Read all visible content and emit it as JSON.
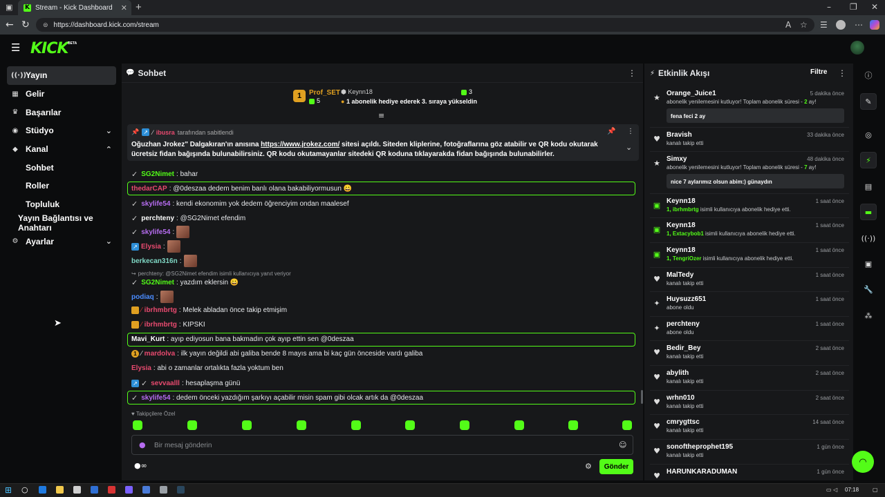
{
  "browser": {
    "tab_title": "Stream - Kick Dashboard",
    "url": "https://dashboard.kick.com/stream"
  },
  "header": {
    "logo": "KICK",
    "beta": "BETA"
  },
  "sidebar": {
    "items": [
      {
        "label": "Yayın",
        "icon": "broadcast-icon"
      },
      {
        "label": "Gelir",
        "icon": "revenue-icon"
      },
      {
        "label": "Başarılar",
        "icon": "trophy-icon"
      },
      {
        "label": "Stüdyo",
        "icon": "studio-icon"
      },
      {
        "label": "Kanal",
        "icon": "channel-icon"
      },
      {
        "label": "Sohbet"
      },
      {
        "label": "Roller"
      },
      {
        "label": "Topluluk"
      },
      {
        "label": "Yayın Bağlantısı ve Anahtarı"
      },
      {
        "label": "Ayarlar",
        "icon": "gear-icon"
      }
    ]
  },
  "chat": {
    "title": "Sohbet",
    "leaderboard": {
      "rank": "1",
      "user": "Prof_SET",
      "gifts": "5",
      "second_user": "Keynn18",
      "second_count": "3",
      "notice": "1 abonelik hediye ederek 3. sıraya yükseldin"
    },
    "pinned": {
      "pinned_by_user": "ibusra",
      "pinned_by_suffix": "tarafından sabitlendi",
      "text_before": "Oğuzhan Jrokez\" Dalgakıran'ın anısına",
      "link": "https://www.jrokez.com/",
      "text_after": "sitesi açıldı. Siteden kliplerine, fotoğraflarına göz atabilir ve QR kodu okutarak ücretsiz fidan",
      "text_line2": "bağışında bulunabilirsiniz. QR kodu okutamayanlar sitedeki QR koduna tıklayarakda fidan bağışında bulunabilirler."
    },
    "messages": [
      {
        "user": "SG2Nimet",
        "text": ": bahar"
      },
      {
        "user": "thedarCAP",
        "text": ": @0deszaa dedem benim banlı olana bakabiliyormusun 😀"
      },
      {
        "user": "skylife54",
        "text": ": kendi ekonomim yok dedem öğrenciyim ondan maalesef"
      },
      {
        "user": "perchteny",
        "text": ": @SG2Nimet efendim"
      },
      {
        "user": "skylife54",
        "text": ":"
      },
      {
        "user": "Elysia",
        "text": ":"
      },
      {
        "user": "berkecan316n",
        "text": ":"
      },
      {
        "reply": "perchteny: @SG2Nimet efendim isimli kullanıcıya yanıt veriyor"
      },
      {
        "user": "SG2Nimet",
        "text": ": yazdım eklersin 😀"
      },
      {
        "user": "podiaq",
        "text": ":"
      },
      {
        "user": "ibrhmbrtg",
        "text": ": Melek abladan önce takip etmişim"
      },
      {
        "user": "ibrhmbrtg",
        "text": ": KIPSKI"
      },
      {
        "user": "Mavi_Kurt",
        "text": ": ayıp ediyosun bana bakmadın çok ayıp ettin sen @0deszaa"
      },
      {
        "user": "mardolva",
        "text": ": ilk yayın değildi abi galiba bende 8 mayıs ama bi kaç gün önceside vardı galiba"
      },
      {
        "user": "Elysia",
        "text": ": abi o zamanlar ortalıkta fazla yoktum ben"
      },
      {
        "user": "sevvaalll",
        "text": ": hesaplaşma günü"
      },
      {
        "user": "skylife54",
        "text": ": dedem önceki yazdığım şarkıyı açabilir misin spam gibi olcak artık da @0deszaa"
      }
    ],
    "emote_section": "Takipçilere Özel",
    "input_placeholder": "Bir mesaj gönderin",
    "send_label": "Gönder"
  },
  "activity": {
    "title": "Etkinlik Akışı",
    "filter_label": "Filtre",
    "events": [
      {
        "name": "Orange_Juice1",
        "time": "5 dakika önce",
        "desc": "abonelik yenilemesini kutluyor! Toplam abonelik süresi -",
        "count": "2",
        "suffix": "ay!",
        "note": "fena feci 2 ay"
      },
      {
        "name": "Bravish",
        "time": "33 dakika önce",
        "desc": "kanalı takip etti"
      },
      {
        "name": "Simxy",
        "time": "48 dakika önce",
        "desc": "abonelik yenilemesini kutluyor! Toplam abonelik süresi -",
        "count": "7",
        "suffix": "ay!",
        "note": "nice 7 aylarımız olsun abim:) günaydın"
      },
      {
        "name": "Keynn18",
        "time": "1 saat önce",
        "gift": "1, ibrhmbrtg",
        "desc": "isimli kullanıcıya abonelik hediye etti."
      },
      {
        "name": "Keynn18",
        "time": "1 saat önce",
        "gift": "1, Extacybob1",
        "desc": "isimli kullanıcıya abonelik hediye etti."
      },
      {
        "name": "Keynn18",
        "time": "1 saat önce",
        "gift": "1, TengriOzer",
        "desc": "isimli kullanıcıya abonelik hediye etti."
      },
      {
        "name": "MalTedy",
        "time": "1 saat önce",
        "desc": "kanalı takip etti"
      },
      {
        "name": "Huysuzz651",
        "time": "1 saat önce",
        "desc": "abone oldu"
      },
      {
        "name": "perchteny",
        "time": "1 saat önce",
        "desc": "abone oldu"
      },
      {
        "name": "Bedir_Bey",
        "time": "2 saat önce",
        "desc": "kanalı takip etti"
      },
      {
        "name": "abylith",
        "time": "2 saat önce",
        "desc": "kanalı takip etti"
      },
      {
        "name": "wrhn010",
        "time": "2 saat önce",
        "desc": "kanalı takip etti"
      },
      {
        "name": "cmrygttsc",
        "time": "14 saat önce",
        "desc": "kanalı takip etti"
      },
      {
        "name": "sonoftheprophet195",
        "time": "1 gün önce",
        "desc": "kanalı takip etti"
      },
      {
        "name": "HARUNKARADUMAN",
        "time": "1 gün önce",
        "desc": ""
      }
    ]
  },
  "taskbar": {
    "time": "07:18"
  },
  "colors": {
    "accent": "#53fc18",
    "bg": "#0b0c0d",
    "panel": "#17181a"
  }
}
